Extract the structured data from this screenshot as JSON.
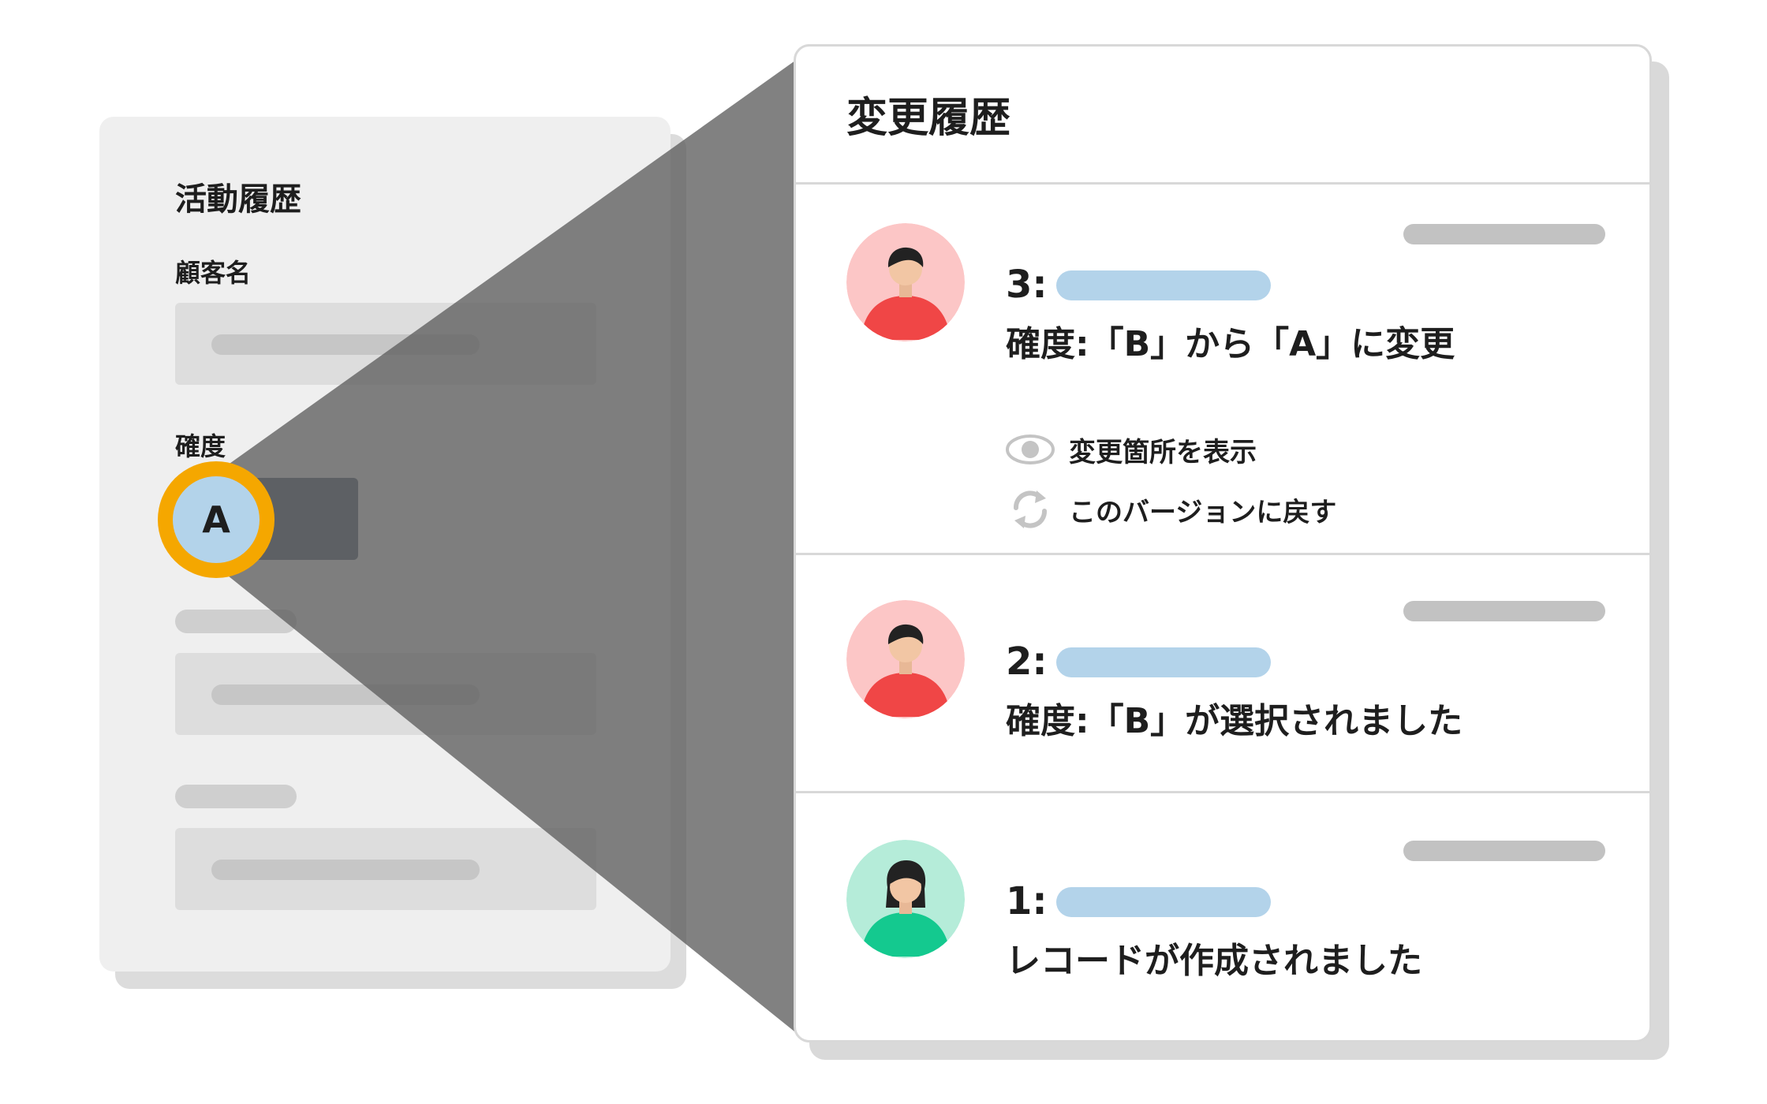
{
  "left_panel": {
    "title": "活動履歴",
    "customer_label": "顧客名",
    "rating_label": "確度",
    "rating_value": "A"
  },
  "history_panel": {
    "title": "変更履歴",
    "entries": [
      {
        "version": "3:",
        "text": "確度:「B」から「A」に変更",
        "avatar": "man-avatar",
        "actions": [
          {
            "label": "変更箇所を表示",
            "icon": "eye-icon"
          },
          {
            "label": "このバージョンに戻す",
            "icon": "revert-icon"
          }
        ]
      },
      {
        "version": "2:",
        "text": "確度:「B」が選択されました",
        "avatar": "man-avatar"
      },
      {
        "version": "1:",
        "text": "レコードが作成されました",
        "avatar": "woman-avatar"
      }
    ]
  },
  "colors": {
    "accent_ring": "#f5a700",
    "badge": "#b3d3ea",
    "man_avatar_bg": "#fcc6c6",
    "man_shirt": "#f04646",
    "woman_avatar_bg": "#b5ecd9",
    "woman_shirt": "#14c98f"
  }
}
